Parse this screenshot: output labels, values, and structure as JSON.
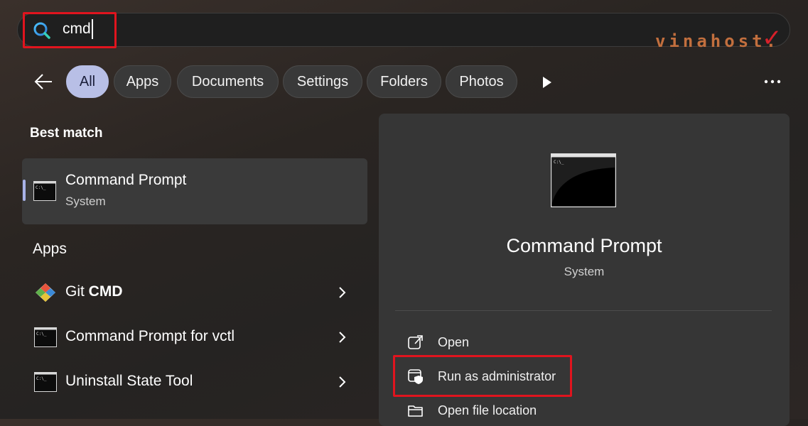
{
  "search": {
    "value": "cmd",
    "placeholder": ""
  },
  "watermark": {
    "text": "vinahost.",
    "check": "✓"
  },
  "filters": [
    {
      "label": "All",
      "active": true
    },
    {
      "label": "Apps"
    },
    {
      "label": "Documents"
    },
    {
      "label": "Settings"
    },
    {
      "label": "Folders"
    },
    {
      "label": "Photos"
    }
  ],
  "icons": {
    "back": "back-arrow-icon",
    "more_filters": "play-icon",
    "more": "more-icon",
    "search": "search-icon",
    "chevron": "chevron-right-icon",
    "command_prompt": "command-prompt-icon",
    "git": "git-icon",
    "open": "open-external-icon",
    "run_admin": "shield-window-icon",
    "open_location": "folder-icon"
  },
  "best_match": {
    "heading": "Best match",
    "title": "Command Prompt",
    "subtitle": "System"
  },
  "apps": {
    "heading": "Apps",
    "items": [
      {
        "label_prefix": "Git ",
        "label_bold": "CMD"
      },
      {
        "label_prefix": "Command Prompt for vctl",
        "label_bold": ""
      },
      {
        "label_prefix": "Uninstall State Tool",
        "label_bold": ""
      }
    ]
  },
  "detail": {
    "title": "Command Prompt",
    "subtitle": "System",
    "actions": [
      {
        "label": "Open"
      },
      {
        "label": "Run as administrator"
      },
      {
        "label": "Open file location"
      }
    ]
  },
  "colors": {
    "highlight_box": "#e0141e",
    "active_filter": "#b8bfe6",
    "watermark": "#c26f3e"
  }
}
